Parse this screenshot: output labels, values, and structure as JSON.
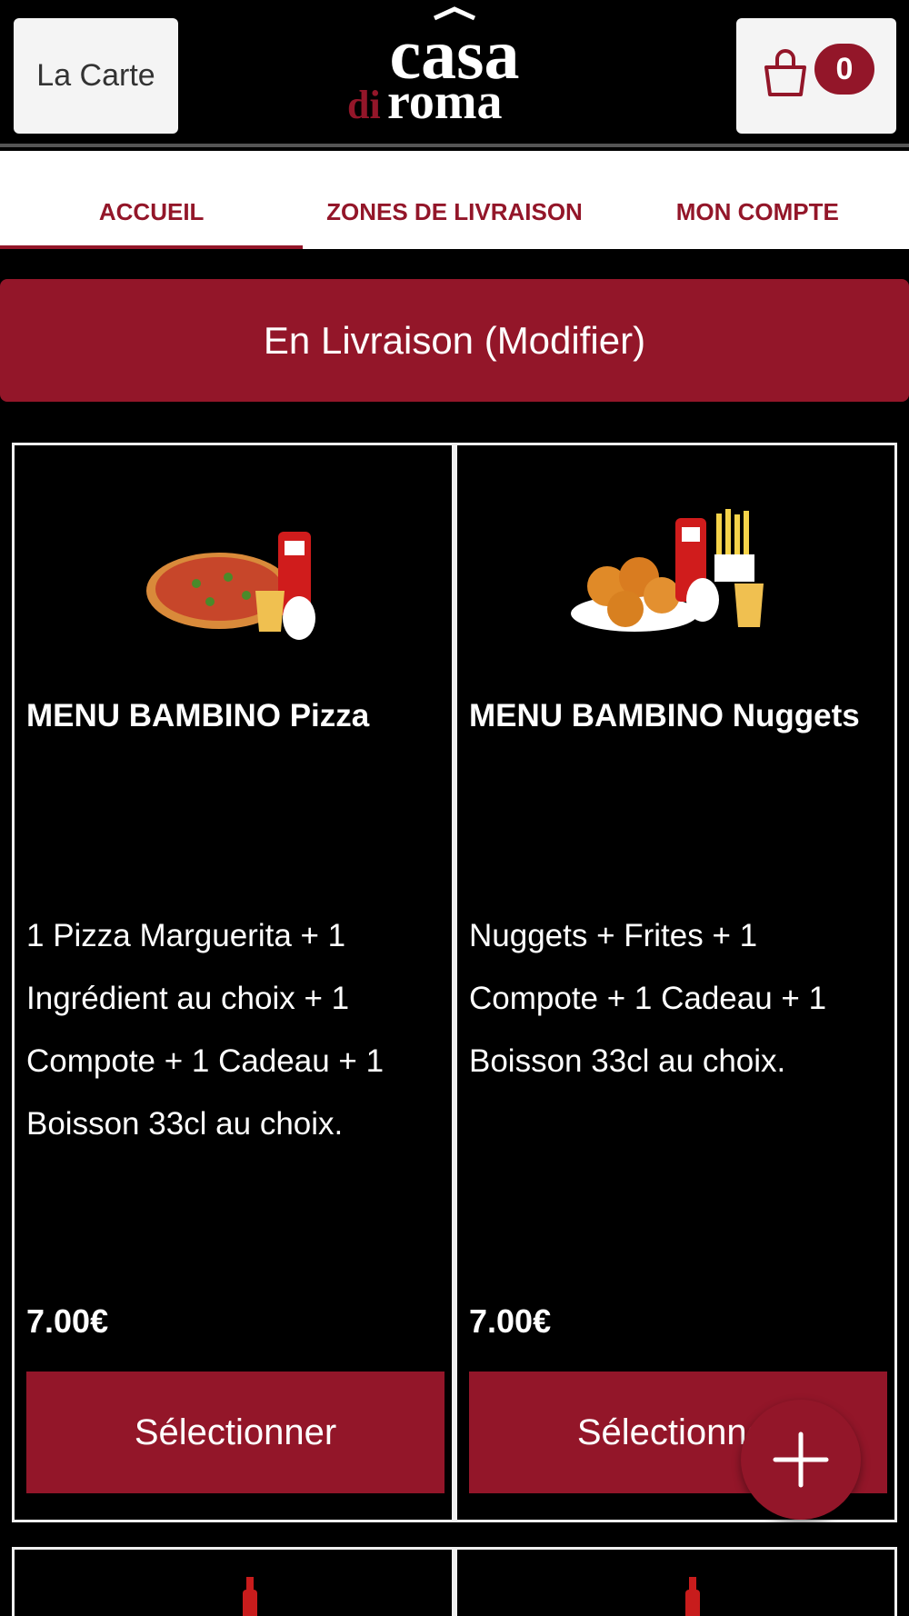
{
  "header": {
    "menu_button": "La Carte",
    "logo": {
      "word_top": "casa",
      "word_di": "di",
      "word_bottom": "roma"
    },
    "cart_count": "0"
  },
  "nav": {
    "tabs": [
      {
        "label": "ACCUEIL",
        "active": true
      },
      {
        "label": "ZONES DE LIVRAISON",
        "active": false
      },
      {
        "label": "MON COMPTE",
        "active": false
      }
    ]
  },
  "delivery_button": "En Livraison (Modifier)",
  "products": [
    {
      "name": "MENU BAMBINO Pizza",
      "description_lines": [
        "1 Pizza Marguerita  + 1",
        "Ingrédient au choix  + 1",
        "Compote  + 1 Cadeau  + 1",
        "Boisson 33cl au choix."
      ],
      "price": "7.00€",
      "button": "Sélectionner",
      "image_icon": "pizza-menu-image"
    },
    {
      "name": "MENU BAMBINO Nuggets",
      "description_lines": [
        "Nuggets  + Frites  + 1",
        "Compote  + 1 Cadeau  + 1",
        "Boisson 33cl au choix."
      ],
      "price": "7.00€",
      "button": "Sélectionner",
      "image_icon": "nuggets-menu-image"
    }
  ],
  "colors": {
    "brand": "#931629",
    "background": "#000000",
    "surface": "#f4f4f4"
  },
  "fab_icon": "plus-icon"
}
